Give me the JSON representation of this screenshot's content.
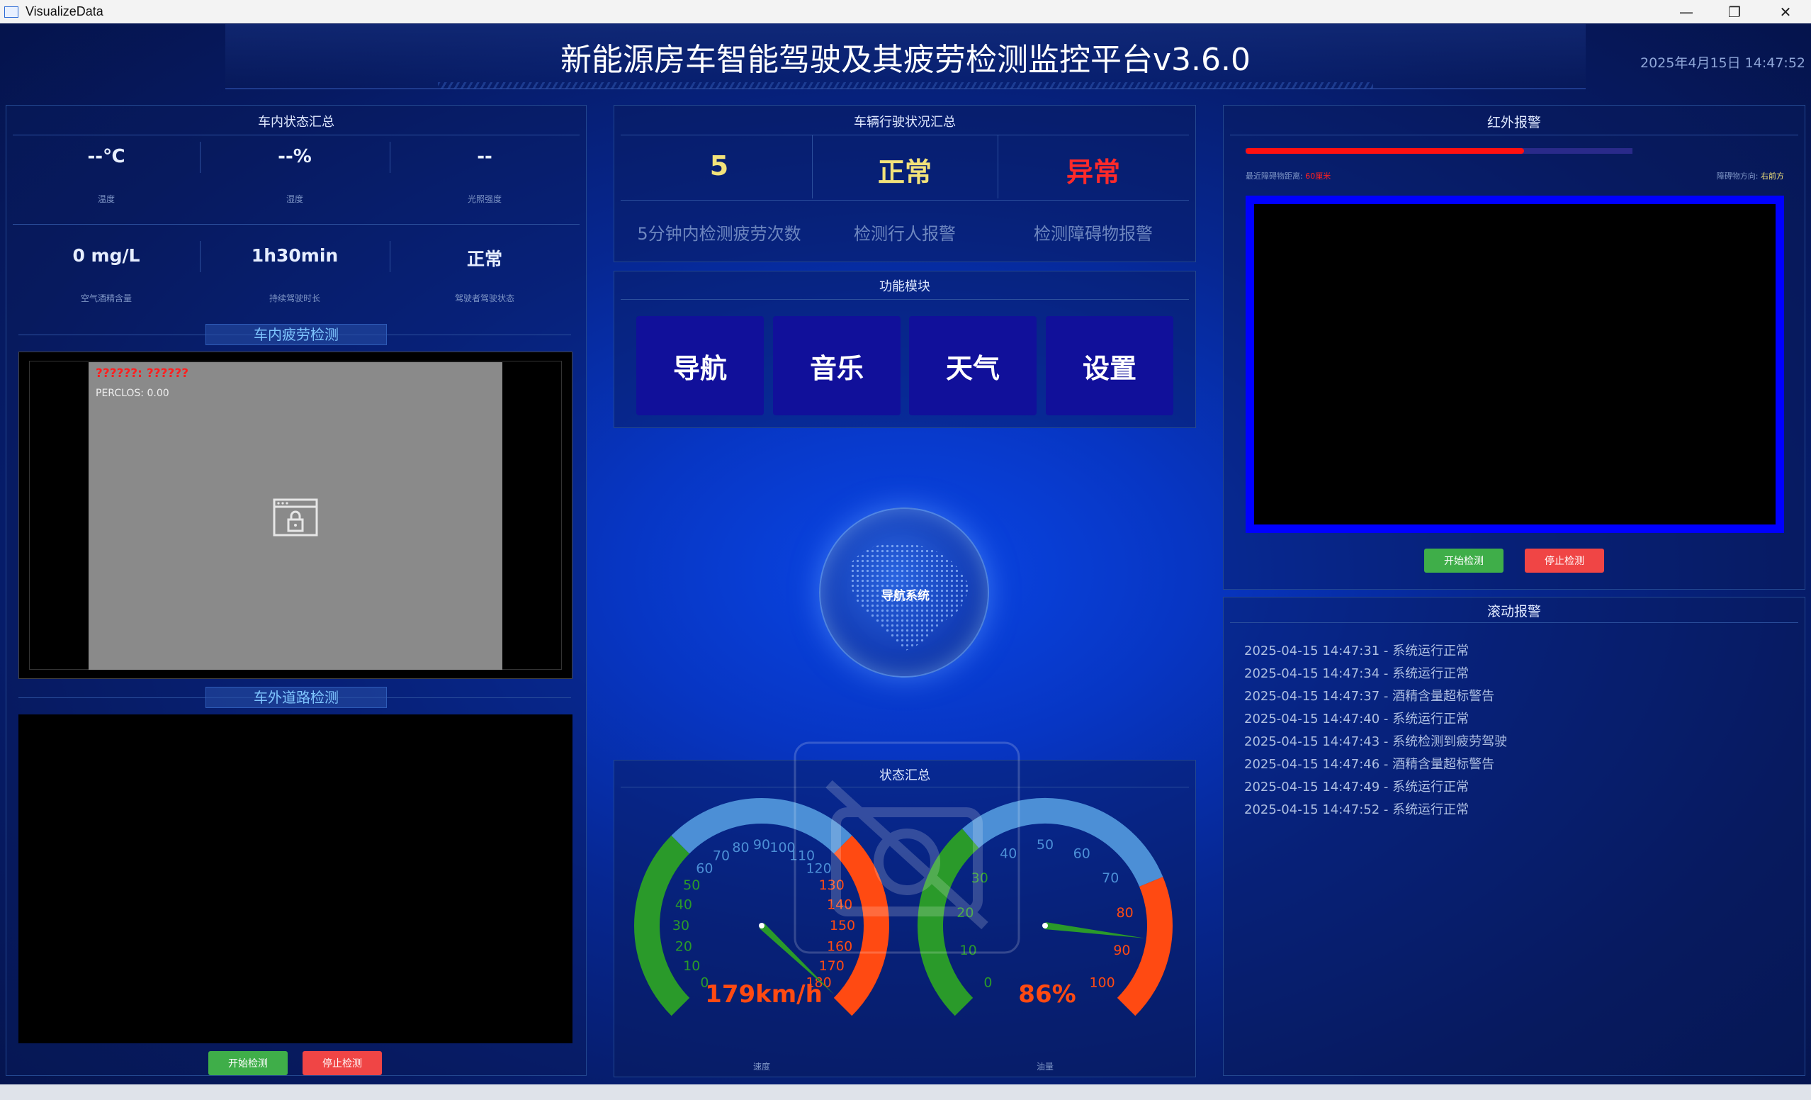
{
  "window": {
    "title": "VisualizeData",
    "minimize": "—",
    "maximize": "❐",
    "close": "✕"
  },
  "header": {
    "title": "新能源房车智能驾驶及其疲劳检测监控平台v3.6.0",
    "datetime": "2025年4月15日 14:47:52"
  },
  "cabin": {
    "title": "车内状态汇总",
    "stats": [
      {
        "value": "--℃",
        "label": "温度"
      },
      {
        "value": "--%",
        "label": "湿度"
      },
      {
        "value": "--",
        "label": "光照强度"
      },
      {
        "value": "0 mg/L",
        "label": "空气酒精含量"
      },
      {
        "value": "1h30min",
        "label": "持续驾驶时长"
      },
      {
        "value": "正常",
        "label": "驾驶者驾驶状态"
      }
    ]
  },
  "fatigue": {
    "title": "车内疲劳检测",
    "status_text": "??????: ??????",
    "perclos": "PERCLOS: 0.00"
  },
  "road": {
    "title": "车外道路检测",
    "start": "开始检测",
    "stop": "停止检测"
  },
  "driving": {
    "title": "车辆行驶状况汇总",
    "items": [
      {
        "value": "5",
        "label": "5分钟内检测疲劳次数",
        "color": "#f2e27a"
      },
      {
        "value": "正常",
        "label": "检测行人报警",
        "color": "#f2e27a"
      },
      {
        "value": "异常",
        "label": "检测障碍物报警",
        "color": "#ff2a2a"
      }
    ]
  },
  "modules": {
    "title": "功能模块",
    "buttons": [
      "导航",
      "音乐",
      "天气",
      "设置"
    ]
  },
  "nav": {
    "globe_label": "导航系统"
  },
  "summary": {
    "title": "状态汇总",
    "speed_label": "速度",
    "fuel_label": "油量"
  },
  "speed_gauge": {
    "value": 179,
    "unit": "km/h",
    "display": "179km/h",
    "min": 0,
    "max": 180,
    "ticks": [
      "0",
      "10",
      "20",
      "30",
      "40",
      "50",
      "60",
      "70",
      "80",
      "90",
      "100",
      "110",
      "120",
      "130",
      "140",
      "150",
      "160",
      "170",
      "180"
    ]
  },
  "fuel_gauge": {
    "value": 86,
    "display": "86%",
    "min": 0,
    "max": 100,
    "ticks": [
      "0",
      "10",
      "20",
      "30",
      "40",
      "50",
      "60",
      "70",
      "80",
      "90",
      "100"
    ]
  },
  "infrared": {
    "title": "红外报警",
    "distance_label": "最近障碍物距离:",
    "distance_value": "60厘米",
    "direction_label": "障碍物方向:",
    "direction_value": "右前方",
    "distance_fraction": 0.72,
    "start": "开始检测",
    "stop": "停止检测"
  },
  "scroll_alarm": {
    "title": "滚动报警",
    "entries": [
      "2025-04-15 14:47:31 - 系统运行正常",
      "2025-04-15 14:47:34 - 系统运行正常",
      "2025-04-15 14:47:37 - 酒精含量超标警告",
      "2025-04-15 14:47:40 - 系统运行正常",
      "2025-04-15 14:47:43 - 系统检测到疲劳驾驶",
      "2025-04-15 14:47:46 - 酒精含量超标警告",
      "2025-04-15 14:47:49 - 系统运行正常",
      "2025-04-15 14:47:52 - 系统运行正常"
    ]
  },
  "colors": {
    "accent_blue": "#0000ff",
    "alarm_red": "#ff1010",
    "gauge_green": "#2a9a2a",
    "gauge_blue": "#4c8fd6",
    "gauge_red": "#ff4a12"
  }
}
